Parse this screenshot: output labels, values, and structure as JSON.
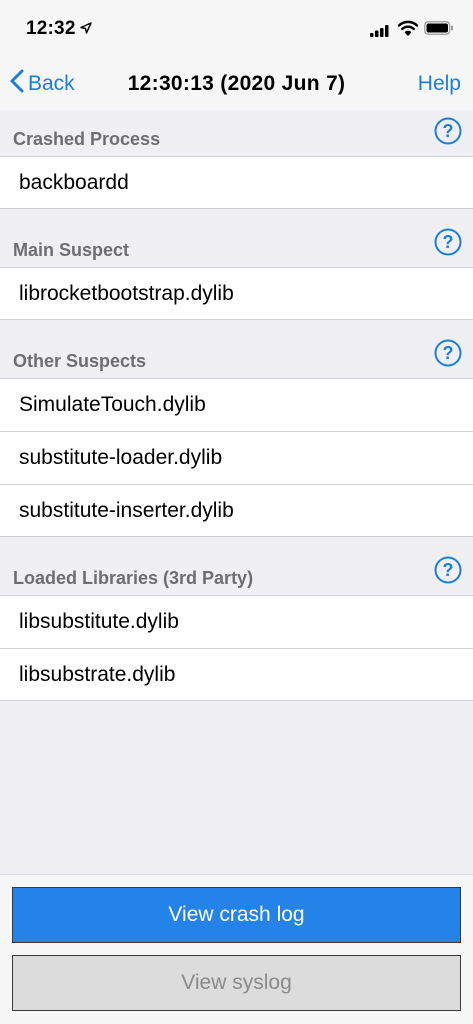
{
  "status_bar": {
    "time": "12:32"
  },
  "nav": {
    "back_label": "Back",
    "title": "12:30:13 (2020 Jun 7)",
    "help_label": "Help"
  },
  "sections": [
    {
      "header": "Crashed Process",
      "items": [
        "backboardd"
      ]
    },
    {
      "header": "Main Suspect",
      "items": [
        "librocketbootstrap.dylib"
      ]
    },
    {
      "header": "Other Suspects",
      "items": [
        "SimulateTouch.dylib",
        "substitute-loader.dylib",
        "substitute-inserter.dylib"
      ]
    },
    {
      "header": "Loaded Libraries (3rd Party)",
      "items": [
        "libsubstitute.dylib",
        "libsubstrate.dylib"
      ]
    }
  ],
  "actions": {
    "view_crash_log": "View crash log",
    "view_syslog": "View syslog"
  },
  "colors": {
    "accent": "#1a7fe0",
    "primary_button": "#2483e8",
    "disabled_button": "#dcdcdc"
  }
}
